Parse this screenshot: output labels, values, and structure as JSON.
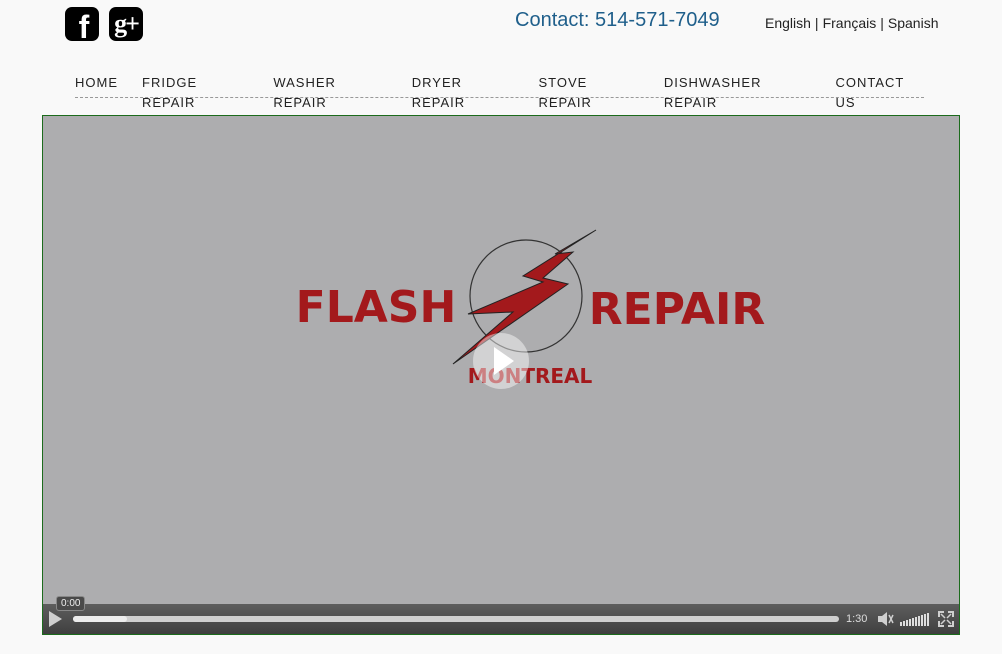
{
  "header": {
    "social": [
      {
        "name": "facebook-icon",
        "glyph": "f"
      },
      {
        "name": "google-plus-icon",
        "glyph": "g+"
      }
    ],
    "contact": "Contact: 514-571-7049",
    "languages": [
      "English",
      "Français",
      "Spanish"
    ],
    "lang_separator": "|"
  },
  "nav": {
    "items": [
      "HOME",
      "FRIDGE REPAIR",
      "WASHER REPAIR",
      "DRYER REPAIR",
      "STOVE REPAIR",
      "DISHWASHER REPAIR",
      "CONTACT US"
    ]
  },
  "video": {
    "logo_left": "FLASH",
    "logo_right": "REPAIR",
    "logo_bottom": "MONTREAL",
    "current_time": "0:00",
    "duration": "1:30",
    "progress": 0.0,
    "buffered": 0.07,
    "brand_color": "#a3191c"
  }
}
